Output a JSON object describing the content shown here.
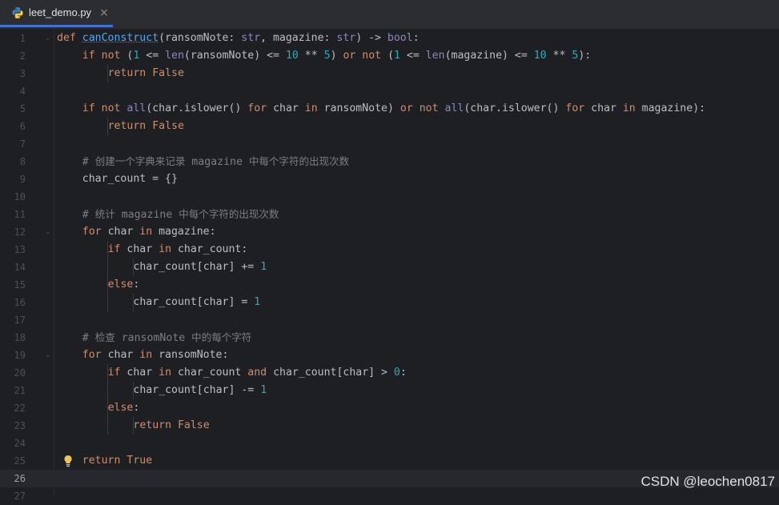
{
  "tab": {
    "filename": "leet_demo.py",
    "close": "×"
  },
  "lines": [
    {
      "n": "1",
      "t": "def canConstruct(ransomNote: str, magazine: str) -> bool:"
    },
    {
      "n": "2",
      "t": "if not (1 <= len(ransomNote) <= 10 ** 5) or not (1 <= len(magazine) <= 10 ** 5):"
    },
    {
      "n": "3",
      "t": "return False"
    },
    {
      "n": "4",
      "t": ""
    },
    {
      "n": "5",
      "t": "if not all(char.islower() for char in ransomNote) or not all(char.islower() for char in magazine):"
    },
    {
      "n": "6",
      "t": "return False"
    },
    {
      "n": "7",
      "t": ""
    },
    {
      "n": "8",
      "t": "# 创建一个字典来记录 magazine 中每个字符的出现次数"
    },
    {
      "n": "9",
      "t": "char_count = {}"
    },
    {
      "n": "10",
      "t": ""
    },
    {
      "n": "11",
      "t": "# 统计 magazine 中每个字符的出现次数"
    },
    {
      "n": "12",
      "t": "for char in magazine:"
    },
    {
      "n": "13",
      "t": "if char in char_count:"
    },
    {
      "n": "14",
      "t": "char_count[char] += 1"
    },
    {
      "n": "15",
      "t": "else:"
    },
    {
      "n": "16",
      "t": "char_count[char] = 1"
    },
    {
      "n": "17",
      "t": ""
    },
    {
      "n": "18",
      "t": "# 检查 ransomNote 中的每个字符"
    },
    {
      "n": "19",
      "t": "for char in ransomNote:"
    },
    {
      "n": "20",
      "t": "if char in char_count and char_count[char] > 0:"
    },
    {
      "n": "21",
      "t": "char_count[char] -= 1"
    },
    {
      "n": "22",
      "t": "else:"
    },
    {
      "n": "23",
      "t": "return False"
    },
    {
      "n": "24",
      "t": ""
    },
    {
      "n": "25",
      "t": "return True"
    },
    {
      "n": "26",
      "t": ""
    },
    {
      "n": "27",
      "t": ""
    }
  ],
  "active_line": "26",
  "watermark": "CSDN @leochen0817",
  "colors": {
    "background": "#1e1f22",
    "keyword": "#cf8e6d",
    "function": "#56a8f5",
    "builtin": "#8888c6",
    "number": "#2aacb8",
    "comment": "#7a7e85",
    "text": "#bcbec4",
    "tab_accent": "#3574f0"
  },
  "icons": [
    "python-file-icon",
    "close-icon",
    "fold-icon",
    "lightbulb-icon"
  ]
}
